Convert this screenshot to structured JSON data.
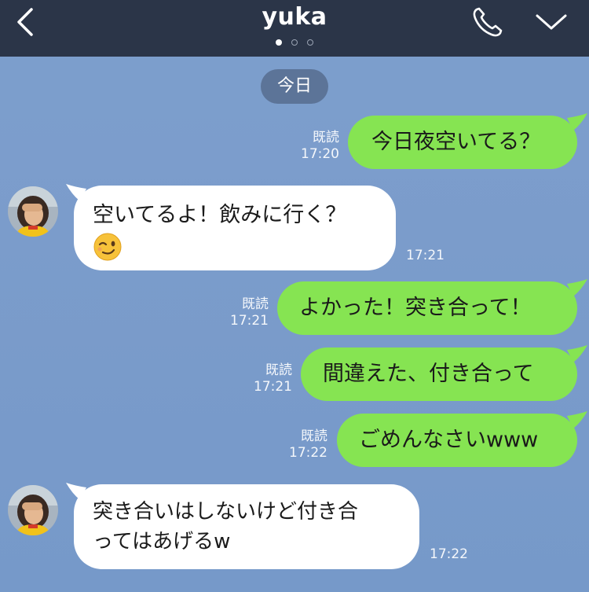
{
  "header": {
    "contact_name": "yuka",
    "page_dots": 3,
    "active_dot": 0
  },
  "date_chip": "今日",
  "messages": [
    {
      "side": "out",
      "text": "今日夜空いてる？",
      "read": "既読",
      "time": "17:20"
    },
    {
      "side": "in",
      "text": "空いてるよ！飲みに行く？",
      "emoji": "winking-face",
      "time": "17:21"
    },
    {
      "side": "out",
      "text": "よかった！突き合って！",
      "read": "既読",
      "time": "17:21"
    },
    {
      "side": "out",
      "text": "間違えた、付き合って",
      "read": "既読",
      "time": "17:21"
    },
    {
      "side": "out",
      "text": "ごめんなさいwww",
      "read": "既読",
      "time": "17:22"
    },
    {
      "side": "in",
      "line1": "突き合いはしないけど付き合",
      "line2": "ってはあげるw",
      "time": "17:22"
    }
  ],
  "colors": {
    "header_bg": "#2b3548",
    "chat_bg": "#7b9ccb",
    "outgoing_bubble": "#86e452",
    "incoming_bubble": "#ffffff",
    "date_chip_bg": "#5c7498"
  },
  "icons": [
    "back-chevron-icon",
    "phone-icon",
    "chevron-down-icon"
  ]
}
